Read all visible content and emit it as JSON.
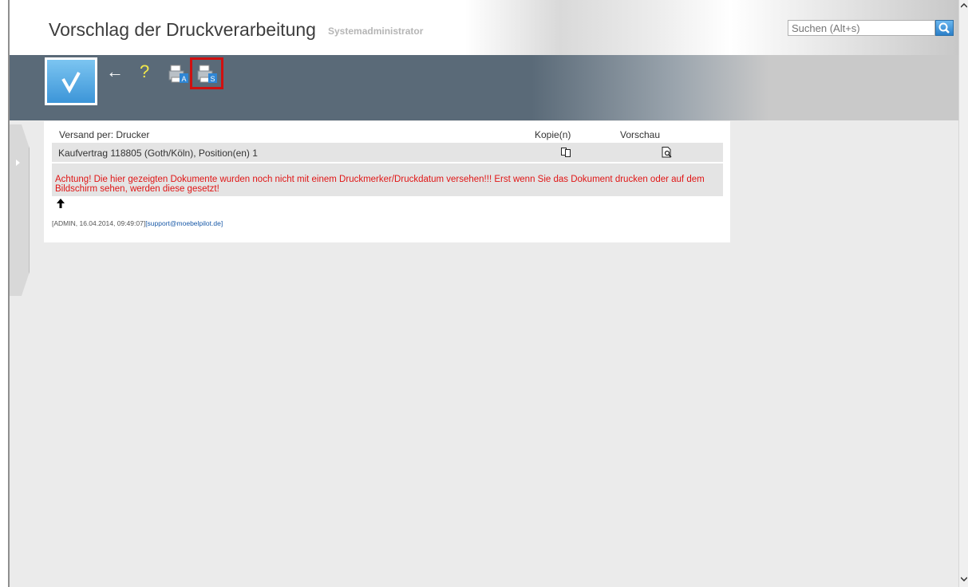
{
  "header": {
    "title": "Vorschlag der Druckverarbeitung",
    "user": "Systemadministrator",
    "search_placeholder": "Suchen (Alt+s)"
  },
  "toolbar": {
    "confirm_label": "√",
    "back_label": "←",
    "help_label": "?",
    "print_a_letter": "A",
    "print_s_letter": "S"
  },
  "table": {
    "col_versand": "Versand per: Drucker",
    "col_kopien": "Kopie(n)",
    "col_vorschau": "Vorschau",
    "row_label": "Kaufvertrag 118805 (Goth/Köln), Position(en) 1"
  },
  "warning": "Achtung! Die hier gezeigten Dokumente wurden noch nicht mit einem Druckmerker/Druckdatum versehen!!! Erst wenn Sie das Dokument drucken oder auf dem Bildschirm sehen, werden diese gesetzt!",
  "footer": {
    "info": "[ADMIN, 16.04.2014, 09:49:07]",
    "email": "[support@moebelpilot.de]"
  },
  "colors": {
    "toolbar_bg": "#5a6a78",
    "accent_blue": "#3c95d8",
    "warning_red": "#e01515",
    "highlight_red": "#d01010"
  }
}
